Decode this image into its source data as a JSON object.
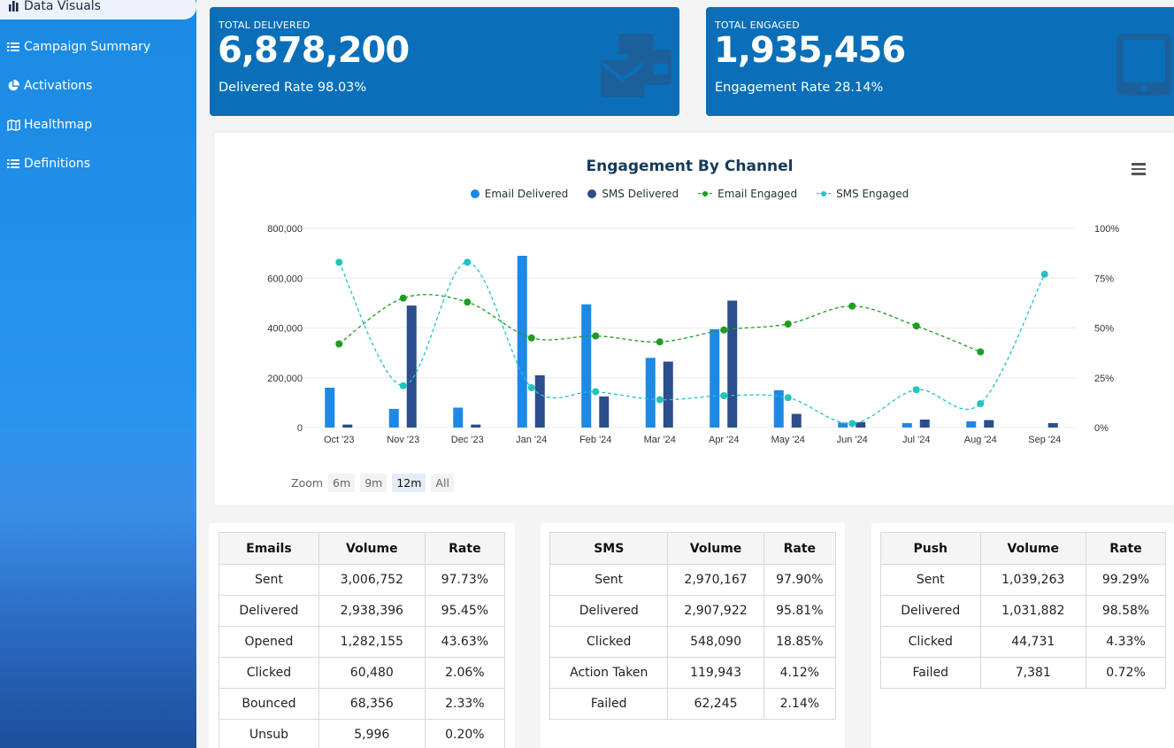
{
  "sidebar": {
    "items": [
      {
        "label": "Data Visuals",
        "icon": "bar-chart-icon"
      },
      {
        "label": "Campaign Summary",
        "icon": "list-icon"
      },
      {
        "label": "Activations",
        "icon": "pie-chart-icon"
      },
      {
        "label": "Healthmap",
        "icon": "map-icon"
      },
      {
        "label": "Definitions",
        "icon": "list-icon"
      }
    ]
  },
  "kpis": {
    "delivered": {
      "caption": "TOTAL DELIVERED",
      "value": "6,878,200",
      "rate": "Delivered Rate 98.03%",
      "icon": "envelopes-icon"
    },
    "engaged": {
      "caption": "TOTAL ENGAGED",
      "value": "1,935,456",
      "rate": "Engagement Rate 28.14%",
      "icon": "tablet-icon"
    }
  },
  "colors": {
    "email_delivered": "#1e88e5",
    "sms_delivered": "#2b4e8c",
    "email_engaged": "#1e9d21",
    "sms_engaged": "#22c3c3",
    "kpi_bg": "#0a6fb8"
  },
  "chart": {
    "menu_icon": "hamburger-icon",
    "zoom_label": "Zoom",
    "zoom_options": [
      "6m",
      "9m",
      "12m",
      "All"
    ],
    "zoom_selected": "12m"
  },
  "chart_data": {
    "type": "bar",
    "title": "Engagement By Channel",
    "categories": [
      "Oct '23",
      "Nov '23",
      "Dec '23",
      "Jan '24",
      "Feb '24",
      "Mar '24",
      "Apr '24",
      "May '24",
      "Jun '24",
      "Jul '24",
      "Aug '24",
      "Sep '24"
    ],
    "y_left": {
      "ticks": [
        "0",
        "200,000",
        "400,000",
        "600,000",
        "800,000"
      ],
      "ylim": [
        0,
        800000
      ]
    },
    "y_right": {
      "ticks": [
        "0%",
        "25%",
        "50%",
        "75%",
        "100%"
      ],
      "ylim": [
        0,
        100
      ]
    },
    "series": [
      {
        "name": "Email Delivered",
        "type": "bar",
        "axis": "left",
        "values": [
          160000,
          75000,
          80000,
          690000,
          495000,
          280000,
          395000,
          150000,
          20000,
          18000,
          25000,
          0
        ]
      },
      {
        "name": "SMS Delivered",
        "type": "bar",
        "axis": "left",
        "values": [
          12000,
          490000,
          12000,
          210000,
          125000,
          265000,
          510000,
          55000,
          22000,
          32000,
          30000,
          18000
        ]
      },
      {
        "name": "Email Engaged",
        "type": "line",
        "axis": "right",
        "values": [
          42,
          65,
          63,
          45,
          46,
          43,
          49,
          52,
          61,
          51,
          38,
          null
        ]
      },
      {
        "name": "SMS Engaged",
        "type": "line",
        "axis": "right",
        "values": [
          83,
          21,
          83,
          20,
          18,
          14,
          16,
          15,
          2,
          19,
          12,
          77
        ]
      }
    ],
    "grid": true,
    "legend": "top-center"
  },
  "tables": [
    {
      "headers": [
        "Emails",
        "Volume",
        "Rate"
      ],
      "rows": [
        [
          "Sent",
          "3,006,752",
          "97.73%"
        ],
        [
          "Delivered",
          "2,938,396",
          "95.45%"
        ],
        [
          "Opened",
          "1,282,155",
          "43.63%"
        ],
        [
          "Clicked",
          "60,480",
          "2.06%"
        ],
        [
          "Bounced",
          "68,356",
          "2.33%"
        ],
        [
          "Unsub",
          "5,996",
          "0.20%"
        ]
      ]
    },
    {
      "headers": [
        "SMS",
        "Volume",
        "Rate"
      ],
      "rows": [
        [
          "Sent",
          "2,970,167",
          "97.90%"
        ],
        [
          "Delivered",
          "2,907,922",
          "95.81%"
        ],
        [
          "Clicked",
          "548,090",
          "18.85%"
        ],
        [
          "Action Taken",
          "119,943",
          "4.12%"
        ],
        [
          "Failed",
          "62,245",
          "2.14%"
        ]
      ]
    },
    {
      "headers": [
        "Push",
        "Volume",
        "Rate"
      ],
      "rows": [
        [
          "Sent",
          "1,039,263",
          "99.29%"
        ],
        [
          "Delivered",
          "1,031,882",
          "98.58%"
        ],
        [
          "Clicked",
          "44,731",
          "4.33%"
        ],
        [
          "Failed",
          "7,381",
          "0.72%"
        ]
      ]
    }
  ]
}
